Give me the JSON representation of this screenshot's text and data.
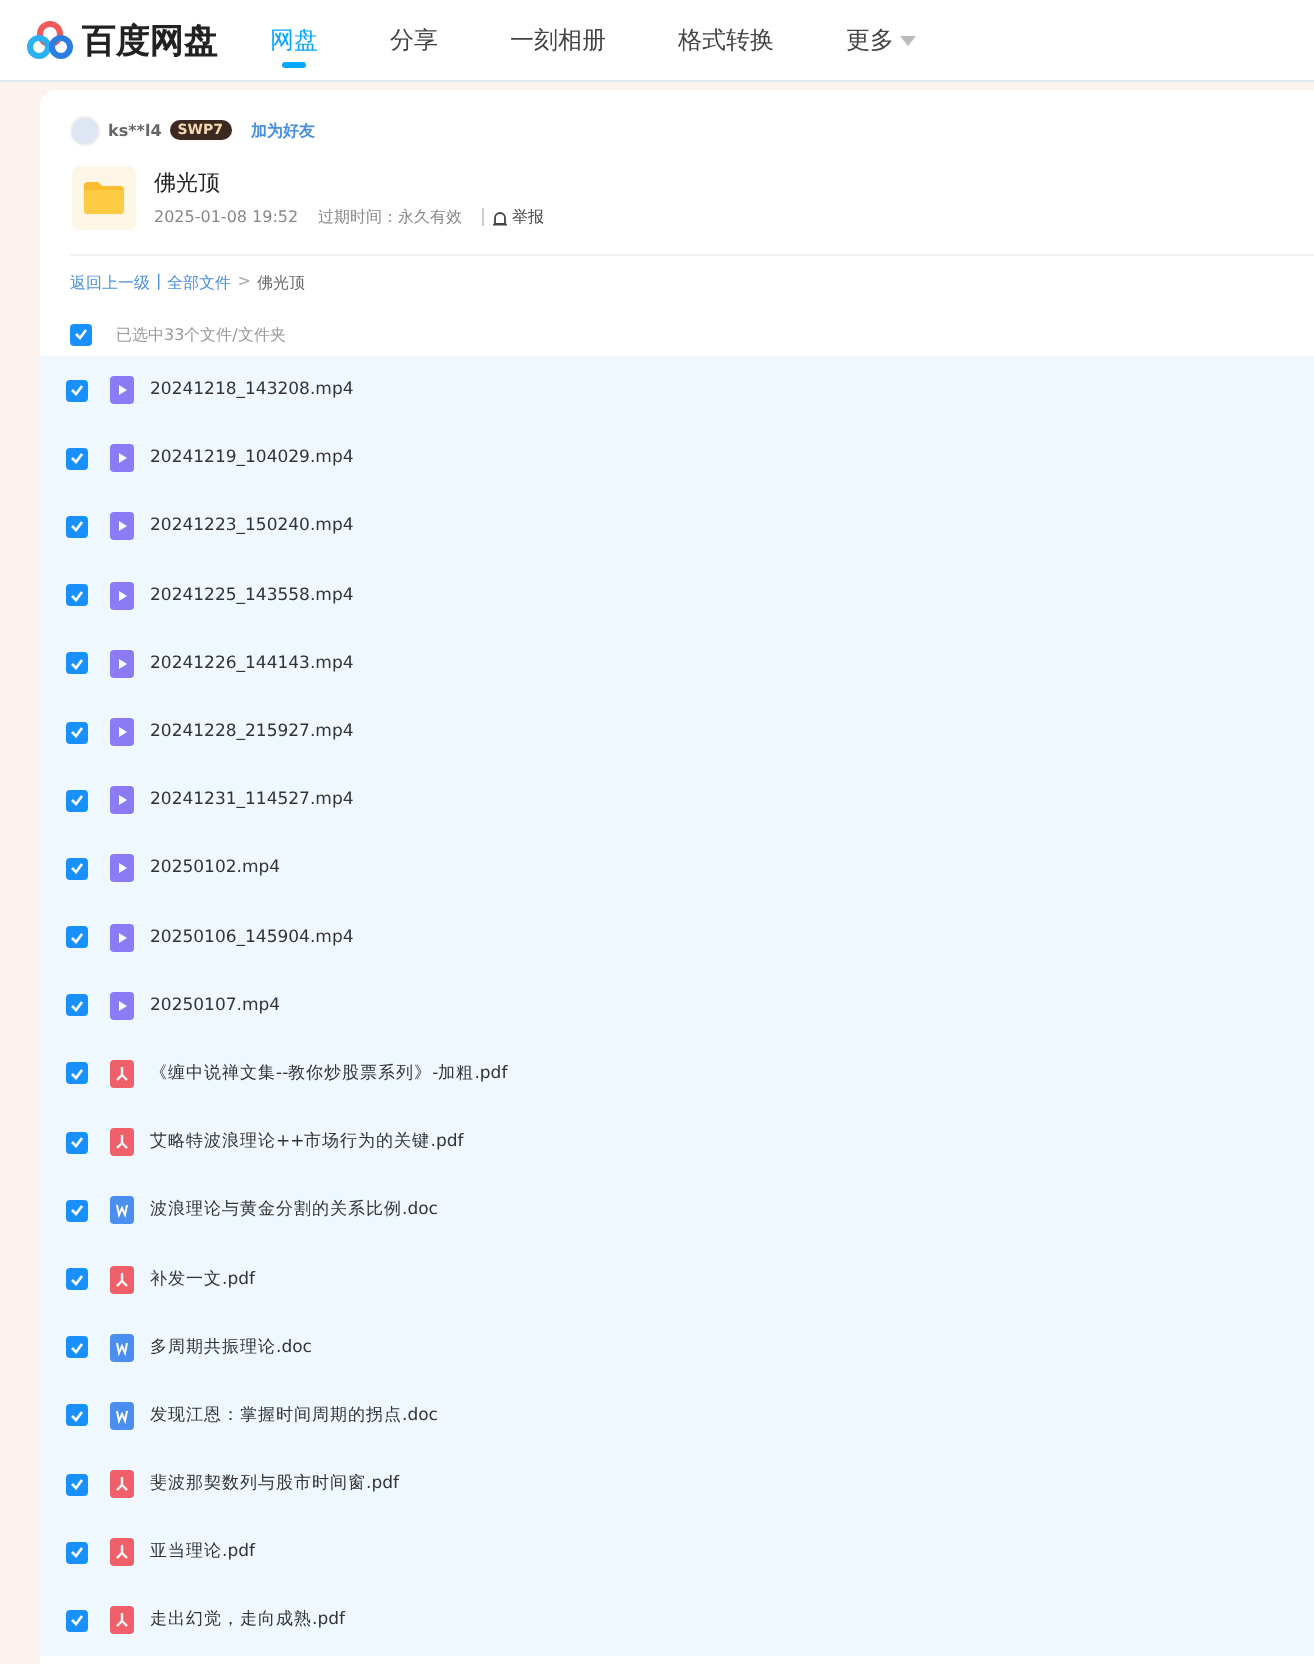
{
  "header": {
    "logo_text": "百度网盘",
    "nav": [
      {
        "label": "网盘",
        "selected": true
      },
      {
        "label": "分享",
        "selected": false
      },
      {
        "label": "一刻相册",
        "selected": false
      },
      {
        "label": "格式转换",
        "selected": false
      },
      {
        "label": "更多",
        "selected": false,
        "dropdown": true
      }
    ]
  },
  "share": {
    "username": "ks**l4",
    "badge": "SWP7",
    "add_friend": "加为好友",
    "folder_name": "佛光顶",
    "date": "2025-01-08 19:52",
    "expiry": "过期时间：永久有效",
    "report": "举报"
  },
  "breadcrumb": {
    "back": "返回上一级",
    "separator": "|",
    "root": "全部文件",
    "arrow": ">",
    "current": "佛光顶"
  },
  "selection": {
    "checked": true,
    "label": "已选中33个文件/文件夹"
  },
  "files": [
    {
      "name": "20241218_143208.mp4",
      "kind": "video",
      "checked": true
    },
    {
      "name": "20241219_104029.mp4",
      "kind": "video",
      "checked": true
    },
    {
      "name": "20241223_150240.mp4",
      "kind": "video",
      "checked": true
    },
    {
      "name": "20241225_143558.mp4",
      "kind": "video",
      "checked": true
    },
    {
      "name": "20241226_144143.mp4",
      "kind": "video",
      "checked": true
    },
    {
      "name": "20241228_215927.mp4",
      "kind": "video",
      "checked": true
    },
    {
      "name": "20241231_114527.mp4",
      "kind": "video",
      "checked": true
    },
    {
      "name": "20250102.mp4",
      "kind": "video",
      "checked": true
    },
    {
      "name": "20250106_145904.mp4",
      "kind": "video",
      "checked": true
    },
    {
      "name": "20250107.mp4",
      "kind": "video",
      "checked": true
    },
    {
      "name": "《缠中说禅文集--教你炒股票系列》-加粗.pdf",
      "kind": "pdf",
      "checked": true
    },
    {
      "name": "艾略特波浪理论++市场行为的关键.pdf",
      "kind": "pdf",
      "checked": true
    },
    {
      "name": "波浪理论与黄金分割的关系比例.doc",
      "kind": "doc",
      "checked": true
    },
    {
      "name": "补发一文.pdf",
      "kind": "pdf",
      "checked": true
    },
    {
      "name": "多周期共振理论.doc",
      "kind": "doc",
      "checked": true
    },
    {
      "name": "发现江恩：掌握时间周期的拐点.doc",
      "kind": "doc",
      "checked": true
    },
    {
      "name": "斐波那契数列与股市时间窗.pdf",
      "kind": "pdf",
      "checked": true
    },
    {
      "name": "亚当理论.pdf",
      "kind": "pdf",
      "checked": true
    },
    {
      "name": "走出幻觉，走向成熟.pdf",
      "kind": "pdf",
      "checked": true
    }
  ]
}
